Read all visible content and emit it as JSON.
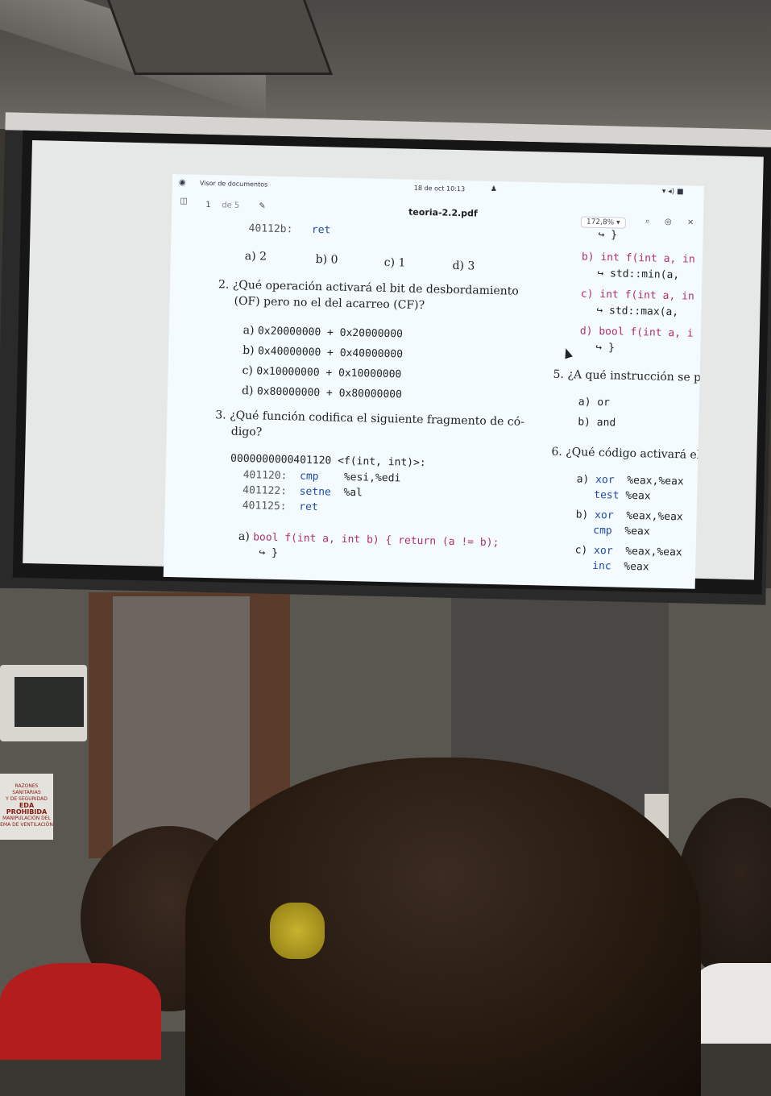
{
  "window": {
    "app_name": "Visor de documentos",
    "clock": "18 de oct 10:13",
    "doc_title": "teoria-2.2.pdf",
    "page_current": "1",
    "page_of": "de 5",
    "zoom": "172,8%"
  },
  "left_col": {
    "top_line_addr": "40112b:",
    "top_line_instr": "ret",
    "q1_options": [
      "a) 2",
      "b) 0",
      "c) 1",
      "d) 3"
    ],
    "q2_line1": "2. ¿Qué operación activará el bit de desbordamiento",
    "q2_line2": "(OF) pero no el del acarreo (CF)?",
    "q2_options": [
      {
        "label": "a)",
        "text": "0x20000000 + 0x20000000"
      },
      {
        "label": "b)",
        "text": "0x40000000 + 0x40000000"
      },
      {
        "label": "c)",
        "text": "0x10000000 + 0x10000000"
      },
      {
        "label": "d)",
        "text": "0x80000000 + 0x80000000"
      }
    ],
    "q3_line1": "3. ¿Qué función codifica el siguiente fragmento de có-",
    "q3_line2": "digo?",
    "asm_header": "0000000000401120 <f(int, int)>:",
    "asm_lines": [
      {
        "addr": "401120:",
        "op": "cmp",
        "args": "%esi,%edi"
      },
      {
        "addr": "401122:",
        "op": "setne",
        "args": "%al"
      },
      {
        "addr": "401125:",
        "op": "ret",
        "args": ""
      }
    ],
    "q3_option_a_label": "a)",
    "q3_option_a_code": "bool f(int a, int b) { return (a != b);",
    "q3_option_a_cont": "↪ }"
  },
  "right_col": {
    "top_frag": "↪ }",
    "opt_b": "b) int f(int a, in",
    "opt_b_cont": "↪ std::min(a,",
    "opt_c": "c) int f(int a, in",
    "opt_c_cont": "↪ std::max(a,",
    "opt_d": "d) bool f(int a, i",
    "opt_d_cont": "↪ }",
    "q5": "5. ¿A qué instrucción se p",
    "q5_options": [
      "a) or",
      "b) and"
    ],
    "q6": "6. ¿Qué código activará el",
    "q6_options": [
      {
        "label": "a)",
        "op1": "xor",
        "args1": "%eax,%eax",
        "op2": "test",
        "args2": "%eax"
      },
      {
        "label": "b)",
        "op1": "xor",
        "args1": "%eax,%eax",
        "op2": "cmp",
        "args2": "%eax"
      },
      {
        "label": "c)",
        "op1": "xor",
        "args1": "%eax,%eax",
        "op2": "inc",
        "args2": "%eax"
      }
    ]
  },
  "room_sign": {
    "line1": "RAZONES SANITARIAS",
    "line2": "Y DE SEGURIDAD",
    "line3": "EDA PROHIBIDA",
    "line4": "MANIPULACIÓN DEL",
    "line5": "EMA DE VENTILACIÓN"
  }
}
